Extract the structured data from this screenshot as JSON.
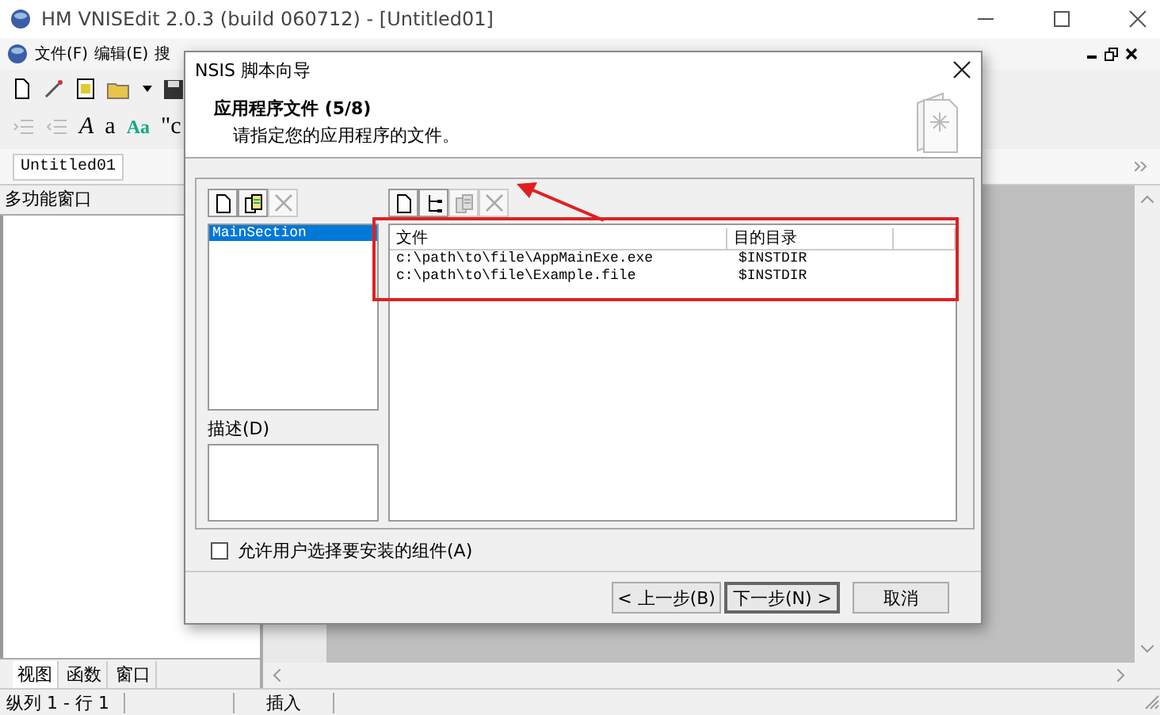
{
  "window": {
    "title": "HM VNISEdit 2.0.3 (build 060712) - [Untitled01]"
  },
  "menu": [
    "文件(F)",
    "编辑(E)",
    "搜"
  ],
  "format_tools": [
    {
      "label": "A",
      "kind": "italic"
    },
    {
      "label": "a",
      "kind": "plain"
    },
    {
      "label": "Aa",
      "kind": "color"
    },
    {
      "label": "\"c",
      "kind": "plain"
    }
  ],
  "document_tabs": [
    {
      "label": "Untitled01",
      "selected": true
    }
  ],
  "side_panel": {
    "title": "多功能窗口",
    "tabs": [
      {
        "label": "视图",
        "selected": true
      },
      {
        "label": "函数",
        "selected": false
      },
      {
        "label": "窗口",
        "selected": false
      }
    ]
  },
  "status_bar": {
    "position": "纵列 1 - 行 1",
    "mode": "插入"
  },
  "dialog": {
    "title": "NSIS 脚本向导",
    "heading": "应用程序文件 (5/8)",
    "subtitle": "请指定您的应用程序的文件。",
    "section_tools": [
      {
        "kind": "new",
        "disabled": false
      },
      {
        "kind": "edit",
        "disabled": false
      },
      {
        "kind": "delete",
        "disabled": true
      }
    ],
    "sections": [
      {
        "label": "MainSection",
        "selected": true
      }
    ],
    "description_label": "描述(D)",
    "file_tools": [
      {
        "kind": "new",
        "disabled": false
      },
      {
        "kind": "tree",
        "disabled": false
      },
      {
        "kind": "edit",
        "disabled": true
      },
      {
        "kind": "delete",
        "disabled": true
      }
    ],
    "columns": [
      "文件",
      "目的目录"
    ],
    "rows": [
      {
        "file": "c:\\path\\to\\file\\AppMainExe.exe",
        "destination": "$INSTDIR"
      },
      {
        "file": "c:\\path\\to\\file\\Example.file",
        "destination": "$INSTDIR"
      }
    ],
    "checkbox": {
      "label": "允许用户选择要安装的组件(A)",
      "checked": false
    },
    "buttons": [
      {
        "label": "< 上一步(B)",
        "default": false
      },
      {
        "label": "下一步(N) >",
        "default": true
      },
      {
        "label": "取消",
        "default": false
      }
    ]
  }
}
